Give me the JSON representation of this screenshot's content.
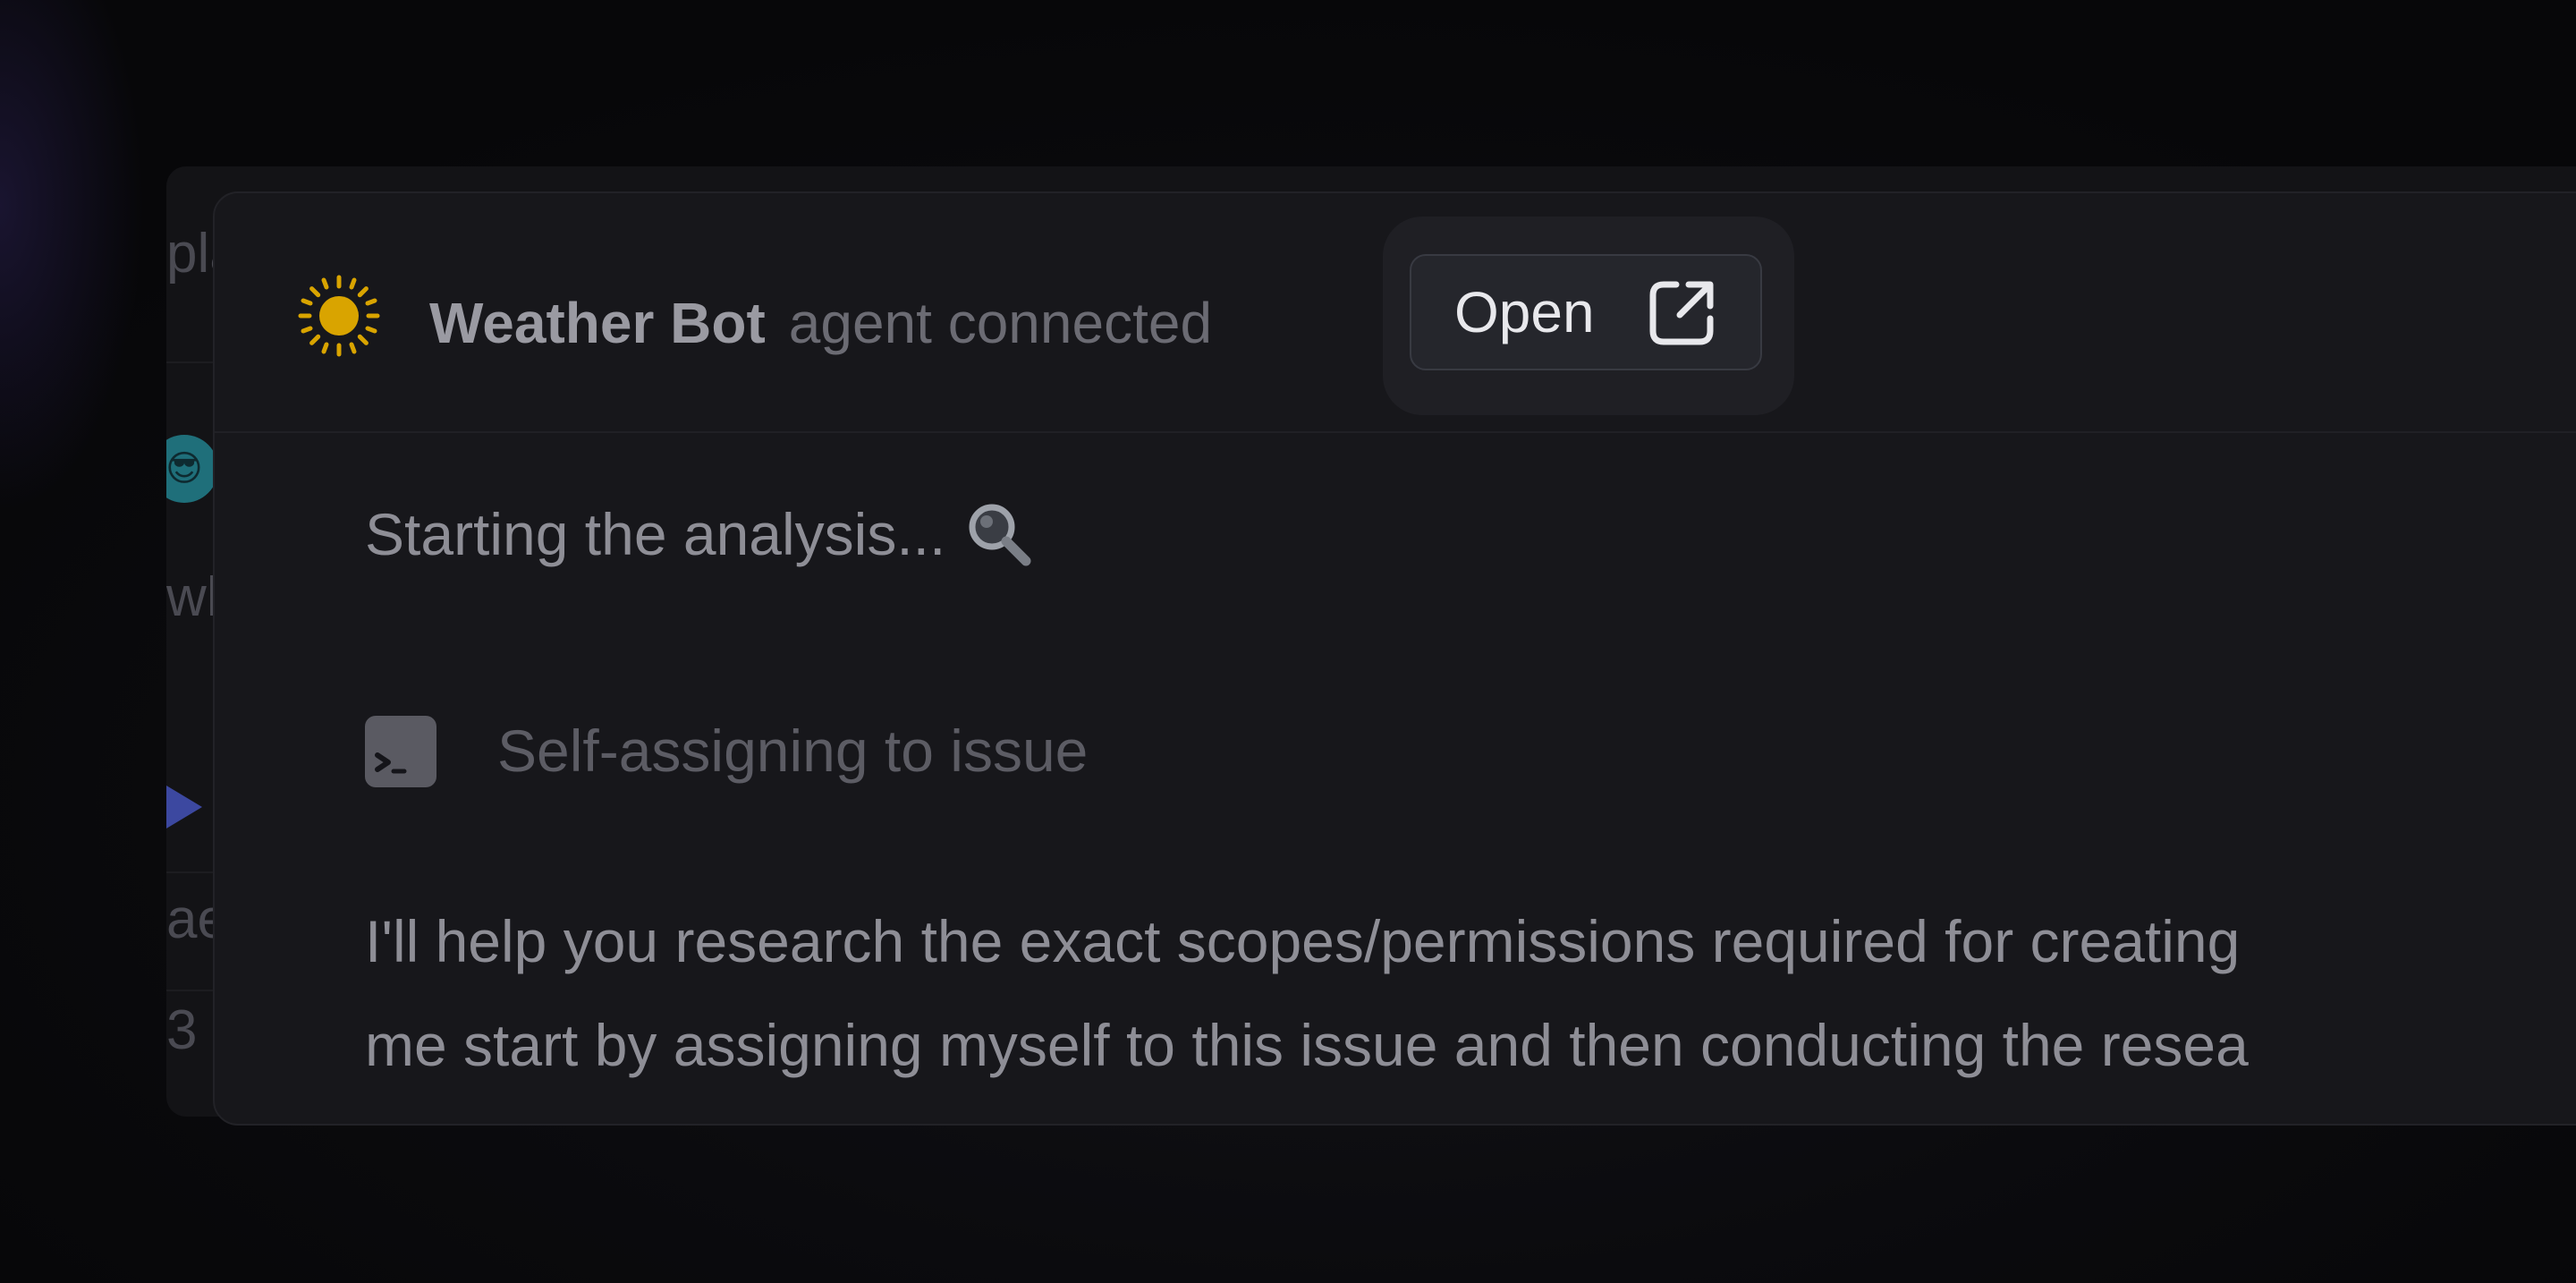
{
  "background_fragments": {
    "row1": "pla",
    "row2": "wh",
    "row3": "ae",
    "row4": "3",
    "emoji": "😎"
  },
  "agent": {
    "name": "Weather Bot",
    "status": "agent connected",
    "icon": "sun-icon",
    "icon_color": "#d9a400"
  },
  "header": {
    "open_label": "Open",
    "open_icon": "external-link-icon"
  },
  "body": {
    "starting_text": "Starting the analysis...",
    "starting_icon": "magnifier-icon",
    "tool_icon": "terminal-icon",
    "tool_label": "Self-assigning to issue",
    "message_lines": [
      "I'll help you research the exact scopes/permissions required for creating",
      "me start by assigning myself to this issue and then conducting the resea"
    ]
  }
}
